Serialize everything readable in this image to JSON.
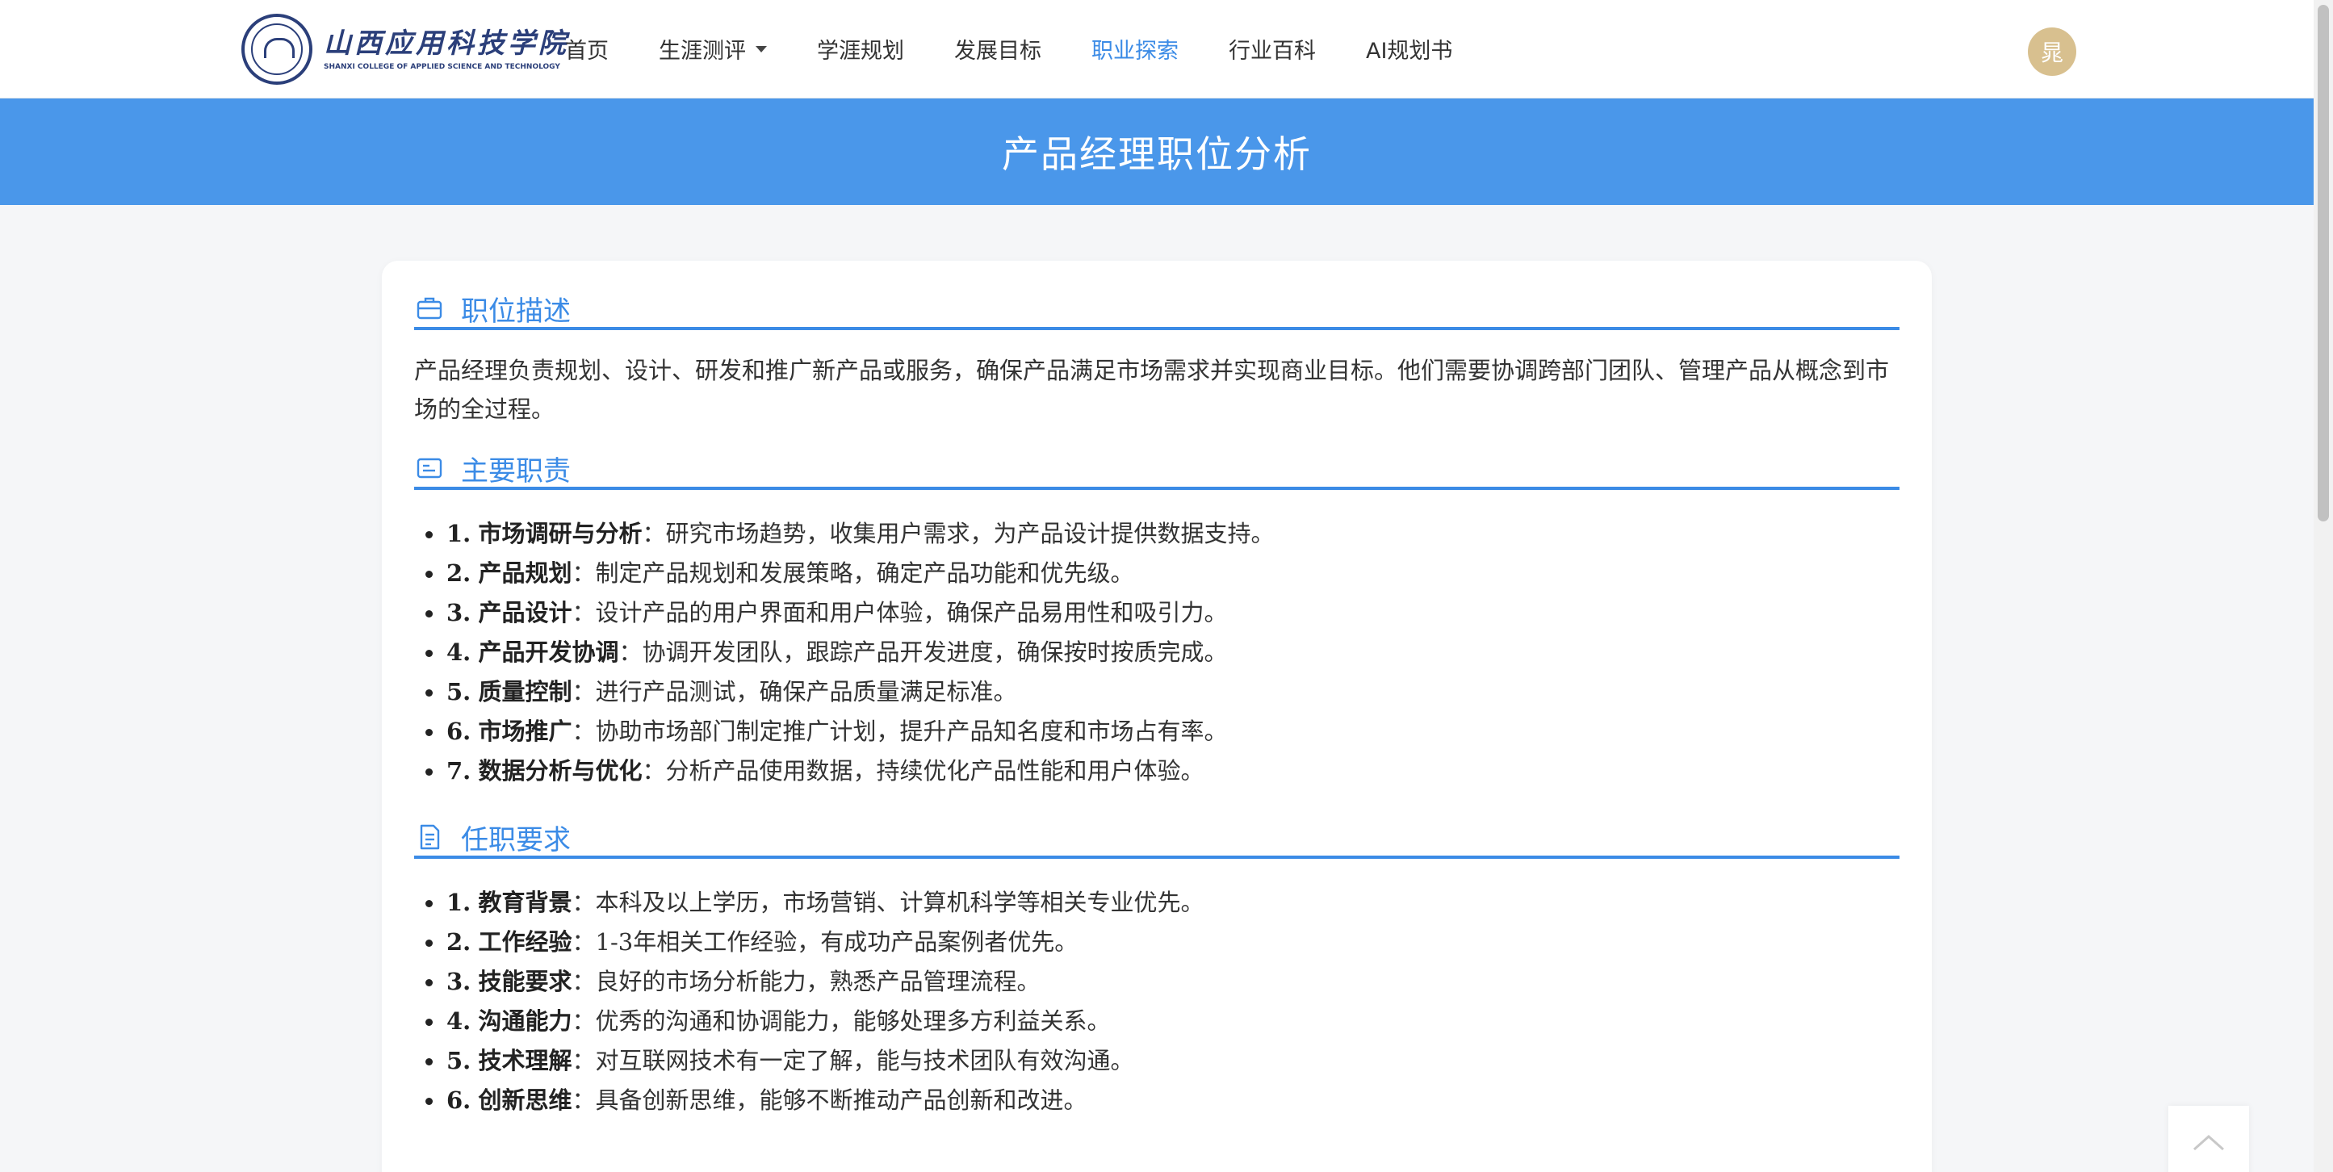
{
  "header": {
    "logo_cn": "山西应用科技学院",
    "logo_en": "SHANXI COLLEGE OF APPLIED SCIENCE AND TECHNOLOGY",
    "nav": [
      {
        "label": "首页"
      },
      {
        "label": "生涯测评"
      },
      {
        "label": "学涯规划"
      },
      {
        "label": "发展目标"
      },
      {
        "label": "职业探索"
      },
      {
        "label": "行业百科"
      },
      {
        "label": "AI规划书"
      }
    ],
    "active_nav": "职业探索",
    "avatar_text": "晁"
  },
  "banner": {
    "title": "产品经理职位分析"
  },
  "sections": {
    "description": {
      "title": "职位描述",
      "icon": "briefcase-icon",
      "text": "产品经理负责规划、设计、研发和推广新产品或服务，确保产品满足市场需求并实现商业目标。他们需要协调跨部门团队、管理产品从概念到市场的全过程。"
    },
    "duties": {
      "title": "主要职责",
      "icon": "id-card-icon",
      "items": [
        {
          "num": "1.",
          "label": "市场调研与分析",
          "sep": "：",
          "text": "研究市场趋势，收集用户需求，为产品设计提供数据支持。"
        },
        {
          "num": "2.",
          "label": "产品规划",
          "sep": "：",
          "text": "制定产品规划和发展策略，确定产品功能和优先级。"
        },
        {
          "num": "3.",
          "label": "产品设计",
          "sep": "：",
          "text": "设计产品的用户界面和用户体验，确保产品易用性和吸引力。"
        },
        {
          "num": "4.",
          "label": "产品开发协调",
          "sep": "：",
          "text": "协调开发团队，跟踪产品开发进度，确保按时按质完成。"
        },
        {
          "num": "5.",
          "label": "质量控制",
          "sep": "：",
          "text": "进行产品测试，确保产品质量满足标准。"
        },
        {
          "num": "6.",
          "label": "市场推广",
          "sep": "：",
          "text": "协助市场部门制定推广计划，提升产品知名度和市场占有率。"
        },
        {
          "num": "7.",
          "label": "数据分析与优化",
          "sep": "：",
          "text": "分析产品使用数据，持续优化产品性能和用户体验。"
        }
      ]
    },
    "requirements": {
      "title": "任职要求",
      "icon": "document-icon",
      "items": [
        {
          "num": "1.",
          "label": "教育背景",
          "sep": "：",
          "text": "本科及以上学历，市场营销、计算机科学等相关专业优先。"
        },
        {
          "num": "2.",
          "label": "工作经验",
          "sep": "：",
          "text": "1-3年相关工作经验，有成功产品案例者优先。"
        },
        {
          "num": "3.",
          "label": "技能要求",
          "sep": "：",
          "text": "良好的市场分析能力，熟悉产品管理流程。"
        },
        {
          "num": "4.",
          "label": "沟通能力",
          "sep": "：",
          "text": "优秀的沟通和协调能力，能够处理多方利益关系。"
        },
        {
          "num": "5.",
          "label": "技术理解",
          "sep": "：",
          "text": "对互联网技术有一定了解，能与技术团队有效沟通。"
        },
        {
          "num": "6.",
          "label": "创新思维",
          "sep": "：",
          "text": "具备创新思维，能够不断推动产品创新和改进。"
        }
      ]
    }
  },
  "colors": {
    "accent": "#3b8be6",
    "banner": "#4a97ea",
    "avatar": "#d8c08f"
  }
}
